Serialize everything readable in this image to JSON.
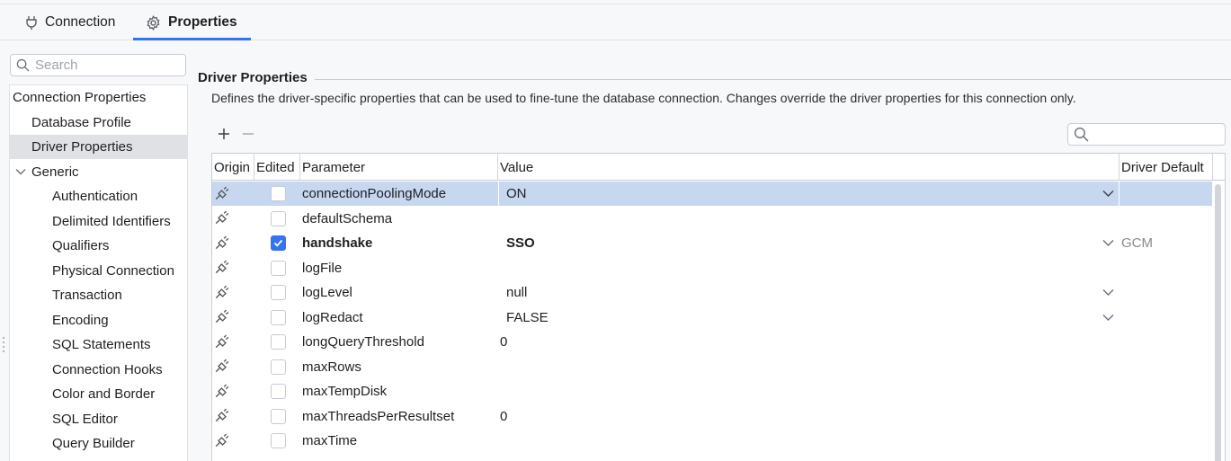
{
  "tabs": [
    {
      "label": "Connection",
      "icon": "plug-icon"
    },
    {
      "label": "Properties",
      "icon": "gear-icon"
    }
  ],
  "search": {
    "placeholder": "Search"
  },
  "tree": {
    "items": [
      {
        "label": "Connection Properties",
        "level": 0
      },
      {
        "label": "Database Profile",
        "level": 1
      },
      {
        "label": "Driver Properties",
        "level": 1,
        "selected": true
      },
      {
        "label": "Generic",
        "level": 1,
        "expanded": true
      },
      {
        "label": "Authentication",
        "level": 2
      },
      {
        "label": "Delimited Identifiers",
        "level": 2
      },
      {
        "label": "Qualifiers",
        "level": 2
      },
      {
        "label": "Physical Connection",
        "level": 2
      },
      {
        "label": "Transaction",
        "level": 2
      },
      {
        "label": "Encoding",
        "level": 2
      },
      {
        "label": "SQL Statements",
        "level": 2
      },
      {
        "label": "Connection Hooks",
        "level": 2
      },
      {
        "label": "Color and Border",
        "level": 2
      },
      {
        "label": "SQL Editor",
        "level": 2
      },
      {
        "label": "Query Builder",
        "level": 2
      }
    ]
  },
  "section": {
    "title": "Driver Properties",
    "description": "Defines the driver-specific properties that can be used to fine-tune the database connection. Changes override the driver properties for this connection only."
  },
  "toolbar": {
    "add": "+",
    "remove": "−"
  },
  "filter": {
    "placeholder": ""
  },
  "table": {
    "headers": {
      "origin": "Origin",
      "edited": "Edited",
      "parameter": "Parameter",
      "value": "Value",
      "default": "Driver Default"
    },
    "rows": [
      {
        "parameter": "connectionPoolingMode",
        "value": "ON",
        "edited": false,
        "dropdown": true,
        "default": "",
        "selected": true
      },
      {
        "parameter": "defaultSchema",
        "value": "",
        "edited": false,
        "dropdown": false,
        "default": ""
      },
      {
        "parameter": "handshake",
        "value": "SSO",
        "edited": true,
        "dropdown": true,
        "default": "GCM",
        "bold": true
      },
      {
        "parameter": "logFile",
        "value": "",
        "edited": false,
        "dropdown": false,
        "default": ""
      },
      {
        "parameter": "logLevel",
        "value": "null",
        "edited": false,
        "dropdown": true,
        "default": ""
      },
      {
        "parameter": "logRedact",
        "value": "FALSE",
        "edited": false,
        "dropdown": true,
        "default": ""
      },
      {
        "parameter": "longQueryThreshold",
        "value": "0",
        "edited": false,
        "dropdown": false,
        "default": ""
      },
      {
        "parameter": "maxRows",
        "value": "",
        "edited": false,
        "dropdown": false,
        "default": ""
      },
      {
        "parameter": "maxTempDisk",
        "value": "",
        "edited": false,
        "dropdown": false,
        "default": ""
      },
      {
        "parameter": "maxThreadsPerResultset",
        "value": "0",
        "edited": false,
        "dropdown": false,
        "default": ""
      },
      {
        "parameter": "maxTime",
        "value": "",
        "edited": false,
        "dropdown": false,
        "default": ""
      }
    ]
  },
  "colors": {
    "accent": "#3574f0",
    "selection": "#c6d7ef",
    "tree_selection": "#dfe1e5"
  }
}
